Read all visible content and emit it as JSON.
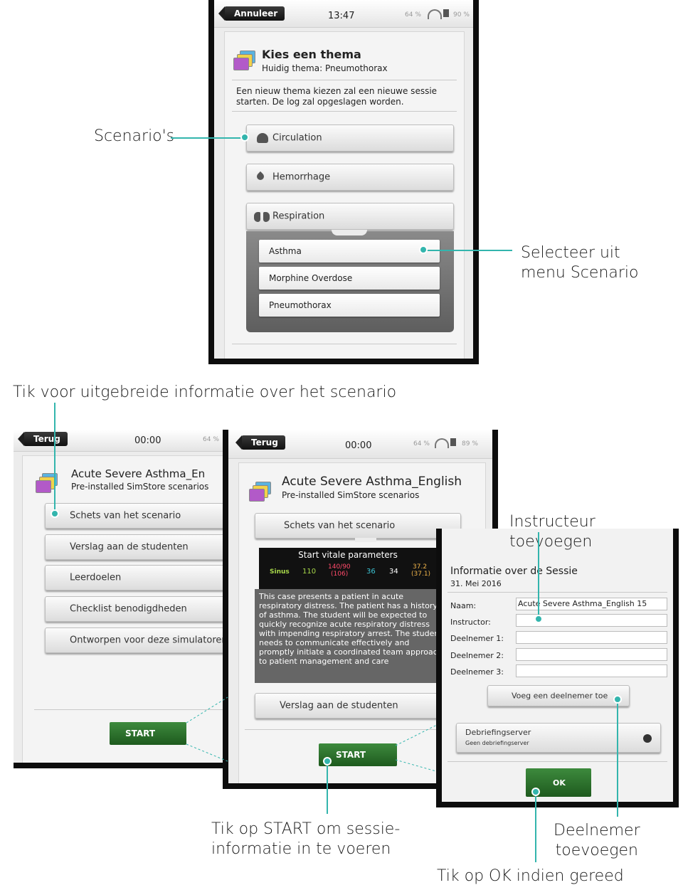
{
  "top": {
    "back_label": "Annuleer",
    "time": "13:47",
    "status": "64 %",
    "battery": "90 %",
    "title": "Kies een thema",
    "subtitle": "Huidig thema: Pneumothorax",
    "info": "Een nieuw thema kiezen zal een nieuwe sessie starten. De log zal opgeslagen worden.",
    "categories": [
      {
        "label": "Circulation",
        "icon": "heart-icon"
      },
      {
        "label": "Hemorrhage",
        "icon": "drop-icon"
      },
      {
        "label": "Respiration",
        "icon": "lungs-icon"
      }
    ],
    "scenarios": [
      "Asthma",
      "Morphine Overdose",
      "Pneumothorax"
    ]
  },
  "left": {
    "back_label": "Terug",
    "time": "00:00",
    "status": "64 %",
    "title": "Acute Severe Asthma_En",
    "subtitle": "Pre-installed SimStore scenarios",
    "menu": [
      "Schets van het scenario",
      "Verslag aan de studenten",
      "Leerdoelen",
      "Checklist benodigdheden",
      "Ontworpen voor deze simulatoren"
    ],
    "start": "START"
  },
  "middle": {
    "back_label": "Terug",
    "time": "00:00",
    "status": "64 %",
    "battery": "89 %",
    "title": "Acute Severe Asthma_English",
    "subtitle": "Pre-installed SimStore scenarios",
    "outline_button": "Schets van het scenario",
    "vitals_title": "Start vitale parameters",
    "vitals": {
      "rhythm": "Sinus",
      "hr": "110",
      "bp": "140/90",
      "bp_sub": "(106)",
      "rr": "36",
      "spo2": "34",
      "temp": "37.2",
      "temp_sub": "(37.1)"
    },
    "description": "This case presents a patient in acute respiratory distress. The patient has a history of asthma. The student will be expected to quickly recognize acute respiratory distress with impending respiratory arrest. The student needs to communicate effectively and promptly initiate a coordinated team approach to patient management and care",
    "report_button": "Verslag aan de studenten",
    "start": "START"
  },
  "session": {
    "title": "Informatie over de Sessie",
    "date": "31. Mei 2016",
    "fields": [
      {
        "label": "Naam:",
        "value": "Acute Severe Asthma_English 15"
      },
      {
        "label": "Instructor:",
        "value": ""
      },
      {
        "label": "Deelnemer 1:",
        "value": ""
      },
      {
        "label": "Deelnemer 2:",
        "value": ""
      },
      {
        "label": "Deelnemer 3:",
        "value": ""
      }
    ],
    "add_participant": "Voeg een deelnemer toe",
    "debrief_title": "Debriefingserver",
    "debrief_sub": "Geen debriefingserver",
    "ok": "OK",
    "behind_title": "Acute Severe Asthma_English"
  },
  "callouts": {
    "scenarios": "Scenario's",
    "select_menu_1": "Selecteer uit",
    "select_menu_2": "menu Scenario",
    "tap_info": "Tik voor uitgebreide informatie over het scenario",
    "add_instructor": "Instructeur toevoegen",
    "tap_start_1": "Tik op START om sessie-",
    "tap_start_2": "informatie in te voeren",
    "add_participant_1": "Deelnemer",
    "add_participant_2": "toevoegen",
    "tap_ok": "Tik op OK indien gereed"
  },
  "colors": {
    "accent": "#33b5ad",
    "start_green": "#2e7a2e"
  }
}
